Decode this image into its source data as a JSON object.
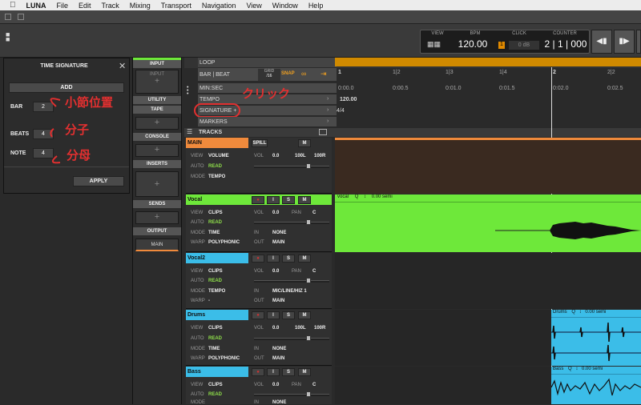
{
  "menubar": {
    "app": "LUNA",
    "items": [
      "File",
      "Edit",
      "Track",
      "Mixing",
      "Transport",
      "Navigation",
      "View",
      "Window",
      "Help"
    ]
  },
  "transport": {
    "view_label": "VIEW",
    "bpm_label": "BPM",
    "bpm_value": "120.00",
    "click_label": "CLICK",
    "click_value": "0 dB",
    "click_num": "1",
    "counter_label": "COUNTER",
    "counter_value": "2 | 1 | 000"
  },
  "time_signature": {
    "title": "TIME SIGNATURE",
    "add": "ADD",
    "bar_label": "BAR",
    "bar_value": "2",
    "beats_label": "BEATS",
    "beats_value": "4",
    "note_label": "NOTE",
    "note_value": "4",
    "apply": "APPLY"
  },
  "annotations": {
    "bar": "小節位置",
    "beats": "分子",
    "note": "分母",
    "click": "クリック"
  },
  "mixer_column": {
    "input": "INPUT",
    "input_slot": "INPUT",
    "utility": "UTILITY",
    "tape": "TAPE",
    "console": "CONSOLE",
    "inserts": "INSERTS",
    "sends": "SENDS",
    "output": "OUTPUT",
    "output_value": "MAIN"
  },
  "rulers": {
    "loop": "LOOP",
    "bar_beat": "BAR | BEAT",
    "grid_label": "GRID",
    "grid_value": "/16",
    "snap": "SNAP",
    "min_sec": "MIN:SEC",
    "tempo": "TEMPO",
    "tempo_value": "120.00",
    "signature": "SIGNATURE +",
    "signature_value": "4/4",
    "markers": "MARKERS",
    "tracks": "TRACKS",
    "bar_ticks": [
      "1",
      "1|2",
      "1|3",
      "1|4",
      "2",
      "2|2"
    ],
    "time_ticks": [
      "0:00.0",
      "0:00.5",
      "0:01.0",
      "0:01.5",
      "0:02.0",
      "0:02.5"
    ]
  },
  "tracks": [
    {
      "name": "MAIN",
      "spill": "SPILL",
      "m": "M",
      "view": "VOLUME",
      "auto": "READ",
      "mode": "TEMPO",
      "vol": "0.0",
      "pan_l": "100L",
      "pan_r": "100R",
      "color": "#f08a3c"
    },
    {
      "name": "Vocal",
      "view": "CLIPS",
      "auto": "READ",
      "mode": "TIME",
      "warp": "POLYPHONIC",
      "vol": "0.0",
      "pan": "C",
      "in": "NONE",
      "out": "MAIN",
      "color": "#6ee83a",
      "clip": "vocal",
      "clip_q": "Q",
      "clip_semi": "0.00 semi"
    },
    {
      "name": "Vocal2",
      "view": "CLIPS",
      "auto": "READ",
      "mode": "TEMPO",
      "warp": "-",
      "vol": "0.0",
      "pan": "C",
      "in": "MIC/LINE/HIZ 1",
      "out": "MAIN",
      "color": "#3bbde8"
    },
    {
      "name": "Drums",
      "view": "CLIPS",
      "auto": "READ",
      "mode": "TIME",
      "warp": "POLYPHONIC",
      "vol": "0.0",
      "pan_l": "100L",
      "pan_r": "100R",
      "in": "NONE",
      "out": "MAIN",
      "color": "#3bbde8",
      "clip": "Drums",
      "clip_q": "Q",
      "clip_semi": "0.00 semi"
    },
    {
      "name": "Bass",
      "view": "CLIPS",
      "auto": "READ",
      "mode": "",
      "vol": "0.0",
      "pan": "C",
      "in": "NONE",
      "color": "#3bbde8",
      "clip": "Bass",
      "clip_q": "Q",
      "clip_semi": "0.00 semi"
    }
  ],
  "labels": {
    "view": "VIEW",
    "auto": "AUTO",
    "mode": "MODE",
    "warp": "WARP",
    "vol": "VOL",
    "pan": "PAN",
    "in": "IN",
    "out": "OUT",
    "i": "I",
    "s": "S",
    "m": "M"
  }
}
